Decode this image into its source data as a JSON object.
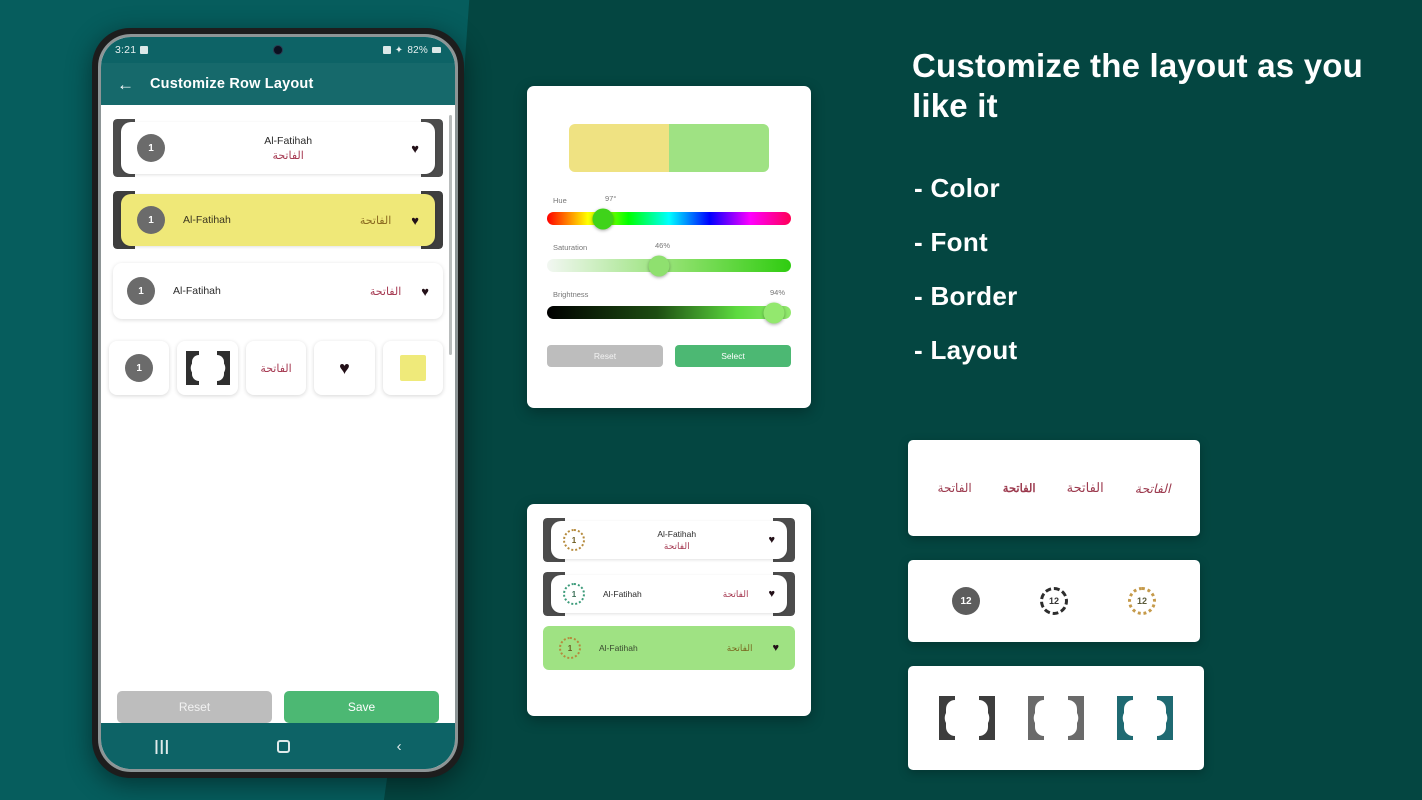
{
  "theme": {
    "bg_teal": "#065d5d",
    "bg_teal_dark": "#044641",
    "appbar_teal": "#16696b",
    "accent_green": "#4cb873",
    "highlight_yellow": "#efe878",
    "highlight_green": "#9fe283",
    "arabic_red": "#a63a52"
  },
  "phone": {
    "status_bar": {
      "time": "3:21",
      "alarm_icon": "alarm-icon",
      "wifi_icon": "wifi-icon",
      "bluetooth_icon": "bluetooth-icon",
      "battery": "82%",
      "battery_icon": "battery-icon"
    },
    "appbar": {
      "back_icon": "←",
      "title": "Customize Row Layout"
    },
    "rows": [
      {
        "number": "1",
        "latin": "Al-Fatihah",
        "arabic": "الفاتحة",
        "fav_icon": "♥",
        "style": "ornate-stacked",
        "highlight": false
      },
      {
        "number": "1",
        "latin": "Al-Fatihah",
        "arabic": "الفاتحة",
        "fav_icon": "♥",
        "style": "ornate-inline",
        "highlight": true
      },
      {
        "number": "1",
        "latin": "Al-Fatihah",
        "arabic": "الفاتحة",
        "fav_icon": "♥",
        "style": "plain-inline",
        "highlight": false
      }
    ],
    "chips": [
      {
        "name": "number-chip",
        "label": "1"
      },
      {
        "name": "border-chip",
        "label": ""
      },
      {
        "name": "arabic-font-chip",
        "label": "الفاتحة"
      },
      {
        "name": "favorite-chip",
        "label": "♥"
      },
      {
        "name": "color-chip",
        "label": ""
      }
    ],
    "actions": {
      "reset": "Reset",
      "save": "Save"
    },
    "navbar": {
      "recents_icon": "|||",
      "home_icon": "square",
      "back_icon": "‹"
    }
  },
  "color_picker": {
    "preview_left": "#efe282",
    "preview_right": "#9fe283",
    "sliders": [
      {
        "label": "Hue",
        "value": "97°",
        "pct": 23
      },
      {
        "label": "Saturation",
        "value": "46%",
        "pct": 46
      },
      {
        "label": "Brightness",
        "value": "94%",
        "pct": 94
      }
    ],
    "knob_colors": {
      "hue": "#3fd31a",
      "saturation": "#8fe06f",
      "brightness": "#93e86e"
    },
    "actions": {
      "reset": "Reset",
      "select": "Select"
    }
  },
  "preview_card": {
    "rows": [
      {
        "number": "1",
        "latin": "Al-Fatihah",
        "arabic": "الفاتحة",
        "fav_icon": "♥",
        "style": "ornate-stacked"
      },
      {
        "number": "1",
        "latin": "Al-Fatihah",
        "arabic": "الفاتحة",
        "fav_icon": "♥",
        "style": "ornate-inline"
      },
      {
        "number": "1",
        "latin": "Al-Fatihah",
        "arabic": "الفاتحة",
        "fav_icon": "♥",
        "style": "green-inline"
      }
    ]
  },
  "promo": {
    "headline": "Customize the layout as you like it",
    "bullets": [
      "- Color",
      "- Font",
      "- Border",
      "- Layout"
    ]
  },
  "samples": {
    "fonts": [
      "الفاتحة",
      "الفاتحة",
      "الفاتحة",
      "الفاتحة"
    ],
    "badges": [
      {
        "label": "12",
        "style": "solid"
      },
      {
        "label": "12",
        "style": "dashed"
      },
      {
        "label": "12",
        "style": "ornate"
      }
    ],
    "borders": [
      {
        "color": "#3d3d3d"
      },
      {
        "color": "#6a6a6a"
      },
      {
        "color": "#1f6a72"
      }
    ]
  }
}
